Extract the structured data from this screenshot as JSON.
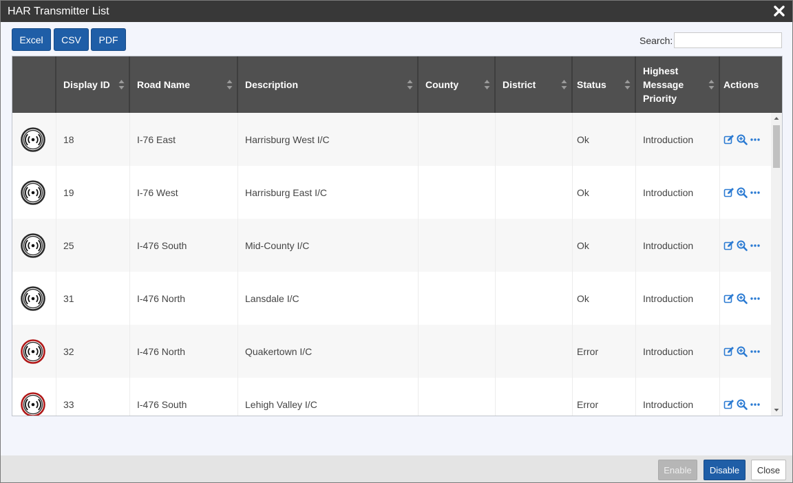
{
  "window": {
    "title": "HAR Transmitter List"
  },
  "toolbar": {
    "excel_label": "Excel",
    "csv_label": "CSV",
    "pdf_label": "PDF",
    "search_label": "Search:",
    "search_value": ""
  },
  "table": {
    "columns": [
      {
        "label": ""
      },
      {
        "label": "Display ID"
      },
      {
        "label": "Road Name"
      },
      {
        "label": "Description"
      },
      {
        "label": "County"
      },
      {
        "label": "District"
      },
      {
        "label": "Status"
      },
      {
        "label": "Highest Message Priority"
      },
      {
        "label": "Actions"
      }
    ],
    "rows": [
      {
        "icon": "radio-transmitter-ok-icon",
        "display_id": "18",
        "road": "I-76 East",
        "description": "Harrisburg West I/C",
        "county": "",
        "district": "",
        "status": "Ok",
        "priority": "Introduction"
      },
      {
        "icon": "radio-transmitter-ok-icon",
        "display_id": "19",
        "road": "I-76 West",
        "description": "Harrisburg East I/C",
        "county": "",
        "district": "",
        "status": "Ok",
        "priority": "Introduction"
      },
      {
        "icon": "radio-transmitter-ok-icon",
        "display_id": "25",
        "road": "I-476 South",
        "description": "Mid-County I/C",
        "county": "",
        "district": "",
        "status": "Ok",
        "priority": "Introduction"
      },
      {
        "icon": "radio-transmitter-ok-icon",
        "display_id": "31",
        "road": "I-476 North",
        "description": "Lansdale I/C",
        "county": "",
        "district": "",
        "status": "Ok",
        "priority": "Introduction"
      },
      {
        "icon": "radio-transmitter-error-icon",
        "display_id": "32",
        "road": "I-476 North",
        "description": "Quakertown I/C",
        "county": "",
        "district": "",
        "status": "Error",
        "priority": "Introduction"
      },
      {
        "icon": "radio-transmitter-error-icon",
        "display_id": "33",
        "road": "I-476 South",
        "description": "Lehigh Valley I/C",
        "county": "",
        "district": "",
        "status": "Error",
        "priority": "Introduction"
      }
    ],
    "row_actions": [
      "edit-icon",
      "zoom-icon",
      "more-icon"
    ]
  },
  "footer": {
    "enable_label": "Enable",
    "disable_label": "Disable",
    "close_label": "Close"
  },
  "colors": {
    "header_bg": "#505050",
    "titlebar_bg": "#383838",
    "primary_button": "#1f5ea7",
    "status_ok_ring": "#2b2b2b",
    "status_error_ring": "#b01818",
    "action_icon": "#2a7ad2"
  }
}
